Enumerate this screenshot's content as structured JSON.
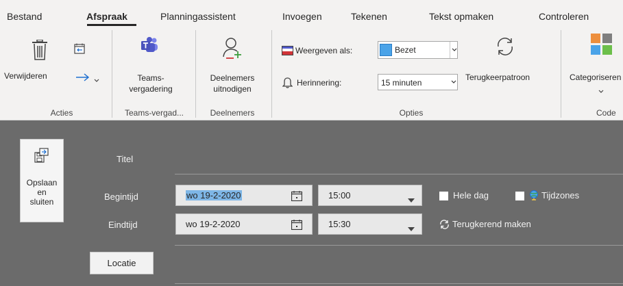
{
  "tabs": [
    {
      "label": "Bestand",
      "active": false
    },
    {
      "label": "Afspraak",
      "active": true
    },
    {
      "label": "Planningassistent",
      "active": false
    },
    {
      "label": "Invoegen",
      "active": false
    },
    {
      "label": "Tekenen",
      "active": false
    },
    {
      "label": "Tekst opmaken",
      "active": false
    },
    {
      "label": "Controleren",
      "active": false
    }
  ],
  "ribbon": {
    "acties": {
      "delete_label": "Verwijderen",
      "group_label": "Acties"
    },
    "teams": {
      "button_label_line1": "Teams-",
      "button_label_line2": "vergadering",
      "group_label": "Teams-vergad..."
    },
    "deelnemers": {
      "button_label_line1": "Deelnemers",
      "button_label_line2": "uitnodigen",
      "group_label": "Deelnemers"
    },
    "opties": {
      "show_as_label": "Weergeven als:",
      "show_as_value": "Bezet",
      "reminder_label": "Herinnering:",
      "reminder_value": "15 minuten",
      "recurrence_label": "Terugkeerpatroon",
      "group_label": "Opties"
    },
    "code": {
      "categorize_label": "Categoriseren",
      "group_label": "Code"
    }
  },
  "form": {
    "save_label": "Opslaan\nen\nsluiten",
    "title_label": "Titel",
    "start_label": "Begintijd",
    "start_date": "wo 19-2-2020",
    "start_time": "15:00",
    "end_label": "Eindtijd",
    "end_date": "wo 19-2-2020",
    "end_time": "15:30",
    "all_day_label": "Hele dag",
    "timezones_label": "Tijdzones",
    "recurring_label": "Terugkerend maken",
    "location_label": "Locatie"
  },
  "colors": {
    "ribbon_bg": "#f3f2f1",
    "form_bg": "#6b6b6b",
    "busy_blue": "#4aa3e8",
    "teams_purple": "#5059c9",
    "selection_blue": "#7eb6e6"
  },
  "icons": [
    "trash-icon",
    "calendar-forward-icon",
    "forward-arrow-icon",
    "teams-icon",
    "add-person-icon",
    "show-as-icon",
    "bell-icon",
    "recurrence-icon",
    "categorize-icon",
    "save-close-icon",
    "calendar-icon",
    "globe-icon",
    "recurring-icon"
  ]
}
